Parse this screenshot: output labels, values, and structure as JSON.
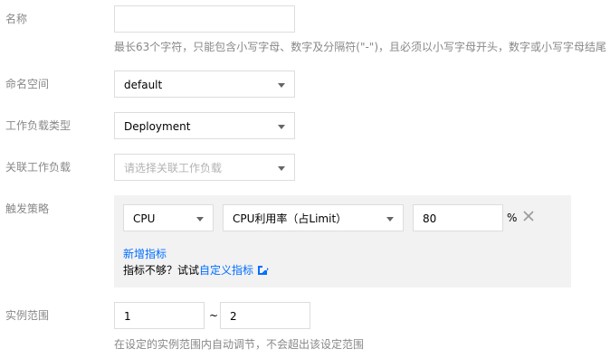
{
  "form": {
    "name": {
      "label": "名称",
      "value": "",
      "help": "最长63个字符，只能包含小写字母、数字及分隔符(\"-\")，且必须以小写字母开头，数字或小写字母结尾"
    },
    "namespace": {
      "label": "命名空间",
      "value": "default"
    },
    "workload_type": {
      "label": "工作负载类型",
      "value": "Deployment"
    },
    "related_workload": {
      "label": "关联工作负载",
      "placeholder": "请选择关联工作负载"
    },
    "trigger_policy": {
      "label": "触发策略",
      "metric_type": "CPU",
      "metric": "CPU利用率（占Limit）",
      "value": "80",
      "unit": "%",
      "remove_icon": "close-icon",
      "add_metric_link": "新增指标",
      "hint_prefix": "指标不够？试试",
      "custom_metric_link": "自定义指标",
      "external_icon": "external-link-icon"
    },
    "instance_range": {
      "label": "实例范围",
      "min": "1",
      "separator": "~",
      "max": "2",
      "help": "在设定的实例范围内自动调节，不会超出该设定范围"
    }
  },
  "colors": {
    "label": "#888888",
    "border": "#dddddd",
    "link": "#006eff",
    "panel_bg": "#f2f2f2",
    "placeholder": "#b3b3b3"
  }
}
